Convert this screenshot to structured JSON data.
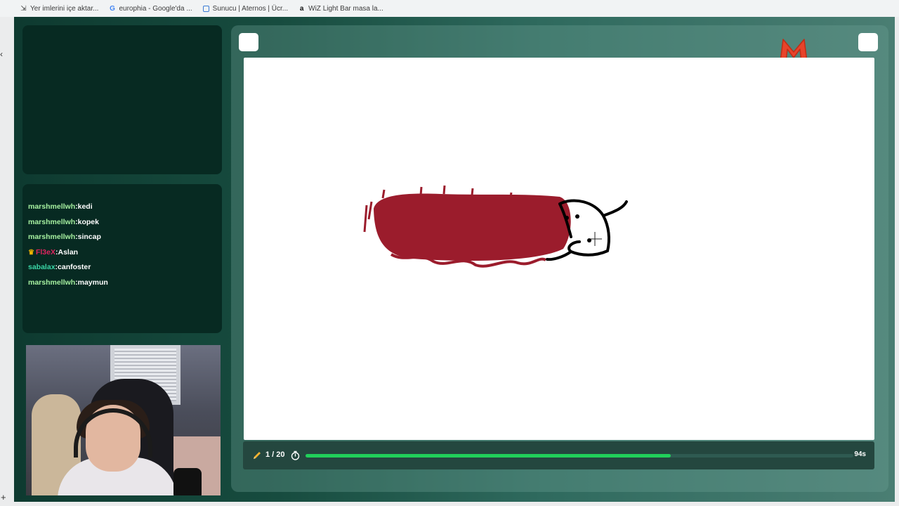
{
  "bookmarks": [
    {
      "label": "Yer imlerini içe aktar...",
      "icon": "import-icon"
    },
    {
      "label": "europhia - Google'da ...",
      "icon": "google-icon"
    },
    {
      "label": "Sunucu | Aternos | Ücr...",
      "icon": "aternos-icon"
    },
    {
      "label": "WiZ Light Bar masa la...",
      "icon": "amazon-icon"
    }
  ],
  "chat": {
    "messages": [
      {
        "user": "marshmellwh",
        "text": ":kedi",
        "user_color": "#a6f0a0",
        "crown": false
      },
      {
        "user": "marshmellwh",
        "text": ":kopek",
        "user_color": "#a6f0a0",
        "crown": false
      },
      {
        "user": "marshmellwh",
        "text": ":sincap",
        "user_color": "#a6f0a0",
        "crown": false
      },
      {
        "user": "Fl3eX",
        "text": ":Aslan",
        "user_color": "#e0245e",
        "crown": true
      },
      {
        "user": "sabalax",
        "text": ":canfoster",
        "user_color": "#3ad6a6",
        "crown": false
      },
      {
        "user": "marshmellwh",
        "text": ":maymun",
        "user_color": "#a6f0a0",
        "crown": false
      }
    ]
  },
  "game": {
    "round_label": "1 / 20",
    "time_left": "94s",
    "time_progress": 0.667,
    "colors": {
      "accent": "#20d05a",
      "logo": "#e8432a",
      "brush_red": "#9b1c2c",
      "brush_black": "#000000"
    }
  }
}
